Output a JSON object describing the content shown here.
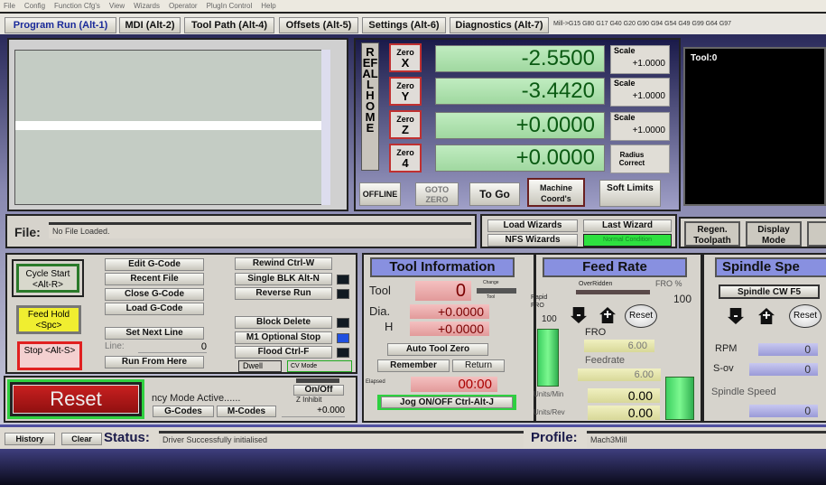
{
  "menu": [
    "File",
    "Config",
    "Function Cfg's",
    "View",
    "Wizards",
    "Operator",
    "PlugIn Control",
    "Help"
  ],
  "tabs": [
    "Program Run (Alt-1)",
    "MDI (Alt-2)",
    "Tool Path (Alt-4)",
    "Offsets (Alt-5)",
    "Settings (Alt-6)",
    "Diagnostics (Alt-7)"
  ],
  "gcode_state": "Mill->G15  G80 G17 G40 G20 G90 G94 G54 G49 G99 G64 G97",
  "dro": {
    "ref_all_home": "REF ALL HOME",
    "axes": [
      {
        "zero_top": "Zero",
        "zero_axis": "X",
        "value": "-2.5500",
        "scale_label": "Scale",
        "scale": "+1.0000"
      },
      {
        "zero_top": "Zero",
        "zero_axis": "Y",
        "value": "-3.4420",
        "scale_label": "Scale",
        "scale": "+1.0000"
      },
      {
        "zero_top": "Zero",
        "zero_axis": "Z",
        "value": "+0.0000",
        "scale_label": "Scale",
        "scale": "+1.0000"
      },
      {
        "zero_top": "Zero",
        "zero_axis": "4",
        "value": "+0.0000",
        "scale_label": "Radius Correct"
      }
    ],
    "buttons": [
      "OFFLINE",
      "GOTO ZERO",
      "To Go",
      "Machine Coord's",
      "Soft Limits"
    ]
  },
  "toolpath": {
    "label": "Tool:0"
  },
  "file": {
    "label": "File:",
    "value": "No File Loaded."
  },
  "wizards": {
    "load": "Load Wizards",
    "last": "Last Wizard",
    "nfs": "NFS Wizards",
    "condition": "Normal Condition"
  },
  "toolpath_buttons": [
    "Regen. Toolpath",
    "Display Mode"
  ],
  "program": {
    "cycle_start": "Cycle Start <Alt-R>",
    "feed_hold": "Feed Hold <Spc>",
    "stop": "Stop <Alt-S>",
    "edit": "Edit G-Code",
    "recent": "Recent File",
    "close": "Close G-Code",
    "load": "Load G-Code",
    "set_next": "Set Next Line",
    "line_label": "Line:",
    "line_value": "0",
    "run_from": "Run From Here",
    "rewind": "Rewind Ctrl-W",
    "single": "Single BLK Alt-N",
    "reverse": "Reverse Run",
    "block_delete": "Block Delete",
    "m1": "M1 Optional Stop",
    "flood": "Flood Ctrl-F",
    "dwell": "Dwell",
    "cv": "CV Mode"
  },
  "reset": {
    "label": "Reset",
    "mode": "ncy Mode Active......",
    "gcodes": "G-Codes",
    "mcodes": "M-Codes",
    "onoff": "On/Off",
    "zinhibit": "Z Inhibit",
    "zvalue": "+0.000"
  },
  "tool": {
    "title": "Tool Information",
    "tool_label": "Tool",
    "tool": "0",
    "change_top": "Change",
    "change_bottom": "Tool",
    "dia_label": "Dia.",
    "dia": "+0.0000",
    "h_label": "H",
    "h": "+0.0000",
    "auto_zero": "Auto Tool Zero",
    "remember": "Remember",
    "return": "Return",
    "elapsed_label": "Elapsed",
    "elapsed": "00:00",
    "jog": "Jog ON/OFF Ctrl-Alt-J"
  },
  "feed": {
    "title": "Feed Rate",
    "overridden": "OverRidden",
    "fro_pct_label": "FRO %",
    "fro_pct": "100",
    "rapid_label": "Rapid FRO",
    "rapid": "100",
    "reset": "Reset",
    "fro_label": "FRO",
    "fro": "6.00",
    "feedrate_label": "Feedrate",
    "feedrate": "6.00",
    "upm_label": "Units/Min",
    "upm": "0.00",
    "upr_label": "Units/Rev",
    "upr": "0.00"
  },
  "spindle": {
    "title": "Spindle Spe",
    "cw": "Spindle CW F5",
    "reset": "Reset",
    "rpm_label": "RPM",
    "rpm": "0",
    "sov_label": "S-ov",
    "sov": "0",
    "speed_label": "Spindle Speed",
    "speed": "0"
  },
  "status": {
    "history": "History",
    "clear": "Clear",
    "label": "Status:",
    "value": "Driver Successfully initialised",
    "profile_label": "Profile:",
    "profile": "Mach3Mill"
  }
}
